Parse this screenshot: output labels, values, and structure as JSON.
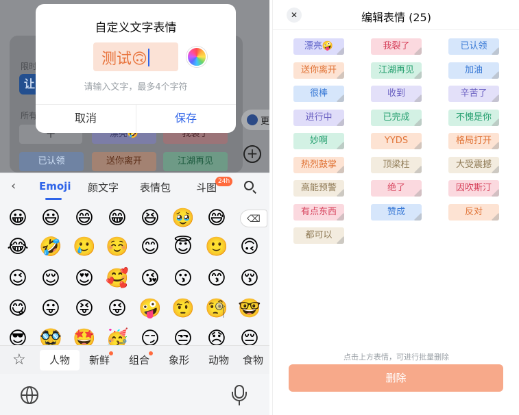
{
  "background": {
    "label_limited": "限时",
    "label_all": "所有",
    "blue_tile": "让",
    "chips": [
      "漂亮🤣",
      "我裂了",
      "已认领",
      "送你离开",
      "江湖再见"
    ],
    "more_text": "更",
    "plus": "+",
    "white_btn": "+"
  },
  "dialog": {
    "title": "自定义文字表情",
    "input_value": "测试🙃",
    "hint": "请输入文字，最多4个字符",
    "cancel_label": "取消",
    "save_label": "保存"
  },
  "keyboard": {
    "back_glyph": "‹",
    "tabs": [
      "Emoji",
      "颜文字",
      "表情包",
      "斗图"
    ],
    "badge": "24h",
    "emoji_rows": [
      [
        "😀",
        "😃",
        "😄",
        "😁",
        "😆",
        "🥹",
        "😅"
      ],
      [
        "😂",
        "🤣",
        "🥲",
        "☺️",
        "😊",
        "😇",
        "🙂",
        "🙃"
      ],
      [
        "😉",
        "😌",
        "😍",
        "🥰",
        "😘",
        "😗",
        "😙",
        "😚"
      ],
      [
        "😋",
        "😛",
        "😝",
        "😜",
        "🤪",
        "🤨",
        "🧐",
        "🤓"
      ],
      [
        "😎",
        "🥸",
        "🤩",
        "🥳",
        "😏",
        "😒",
        "😞",
        "😔"
      ]
    ],
    "backspace_glyph": "⌫",
    "categories": [
      "人物",
      "新鲜",
      "组合",
      "象形",
      "动物",
      "食物"
    ],
    "star_glyph": "☆"
  },
  "editor": {
    "close_glyph": "✕",
    "title": "编辑表情 (25)",
    "chips": [
      {
        "label": "漂亮🤪",
        "bg": "#dcdcfb",
        "fg": "#5b5fc7"
      },
      {
        "label": "我裂了",
        "bg": "#fbd9df",
        "fg": "#d6405a"
      },
      {
        "label": "已认领",
        "bg": "#d6e6fb",
        "fg": "#3a7ad6"
      },
      {
        "label": "送你离开",
        "bg": "#fde3d3",
        "fg": "#e07336"
      },
      {
        "label": "江湖再见",
        "bg": "#d3f1e4",
        "fg": "#27a070"
      },
      {
        "label": "加油",
        "bg": "#d6e6fb",
        "fg": "#3a7ad6"
      },
      {
        "label": "很棒",
        "bg": "#d6e6fb",
        "fg": "#3a7ad6"
      },
      {
        "label": "收到",
        "bg": "#e3e0f9",
        "fg": "#6b61c2"
      },
      {
        "label": "辛苦了",
        "bg": "#e3e0f9",
        "fg": "#6b61c2"
      },
      {
        "label": "进行中",
        "bg": "#e0ddf9",
        "fg": "#6b61c2"
      },
      {
        "label": "已完成",
        "bg": "#d3f1e4",
        "fg": "#27a070"
      },
      {
        "label": "不愧是你",
        "bg": "#d3f1e4",
        "fg": "#27a070"
      },
      {
        "label": "妙啊",
        "bg": "#d3f1e4",
        "fg": "#27a070"
      },
      {
        "label": "YYDS",
        "bg": "#fde3d3",
        "fg": "#e07336"
      },
      {
        "label": "格局打开",
        "bg": "#fde3d3",
        "fg": "#e07336"
      },
      {
        "label": "热烈鼓掌",
        "bg": "#fde3d3",
        "fg": "#e07336"
      },
      {
        "label": "顶梁柱",
        "bg": "#f3ecdf",
        "fg": "#8f7a55"
      },
      {
        "label": "大受震撼",
        "bg": "#f3ecdf",
        "fg": "#8f7a55"
      },
      {
        "label": "高能预警",
        "bg": "#f3ecdf",
        "fg": "#8f7a55"
      },
      {
        "label": "绝了",
        "bg": "#fbd9df",
        "fg": "#d6405a"
      },
      {
        "label": "因吹斯汀",
        "bg": "#fbd9df",
        "fg": "#d6405a"
      },
      {
        "label": "有点东西",
        "bg": "#fbd9df",
        "fg": "#d6405a"
      },
      {
        "label": "赞成",
        "bg": "#d6e6fb",
        "fg": "#3a7ad6"
      },
      {
        "label": "反对",
        "bg": "#fde3d3",
        "fg": "#e07336"
      },
      {
        "label": "都可以",
        "bg": "#f3ecdf",
        "fg": "#8f7a55"
      }
    ],
    "footnote": "点击上方表情，可进行批量删除",
    "delete_label": "删除"
  },
  "colors": {
    "accent_blue": "#2f64e8",
    "delete_button": "#f7a98a"
  }
}
